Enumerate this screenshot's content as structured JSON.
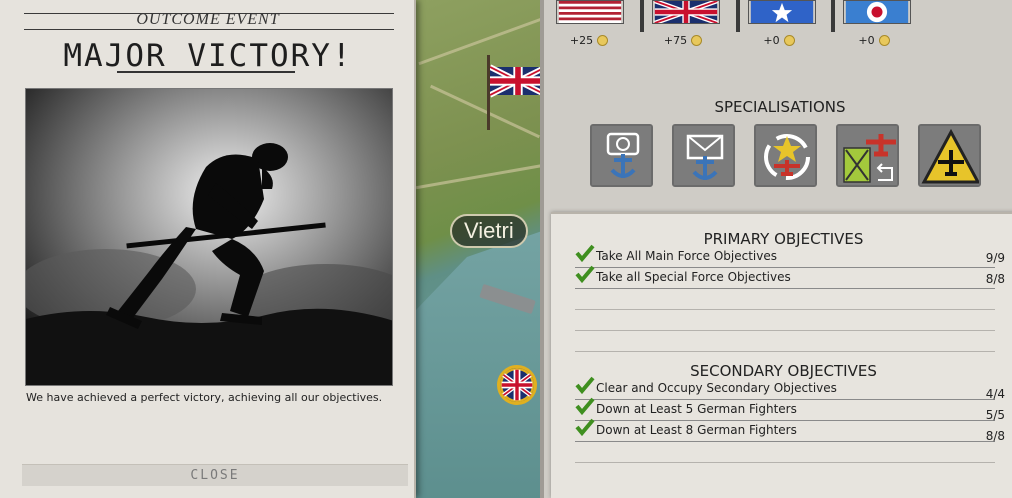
{
  "outcome": {
    "event_label": "OUTCOME EVENT",
    "title": "MAJOR VICTORY!",
    "description": "We have achieved a perfect victory, achieving all our objectives.",
    "close_label": "CLOSE"
  },
  "map": {
    "town_label": "Vietri"
  },
  "nations": [
    {
      "flag_icon": "usa-flag-icon",
      "amount": "+25"
    },
    {
      "flag_icon": "uk-flag-icon",
      "amount": "+75"
    },
    {
      "flag_icon": "free-france-flag-icon",
      "amount": "+0"
    },
    {
      "flag_icon": "raf-roundel-icon",
      "amount": "+0"
    }
  ],
  "specialisations": {
    "title": "SPECIALISATIONS",
    "icons": [
      "naval-recon-icon",
      "naval-mail-icon",
      "air-cycle-icon",
      "air-supply-icon",
      "air-warning-icon"
    ]
  },
  "objectives": {
    "primary_title": "PRIMARY OBJECTIVES",
    "primary": [
      {
        "label": "Take All Main Force Objectives",
        "score": "9/9"
      },
      {
        "label": "Take all Special Force  Objectives",
        "score": "8/8"
      }
    ],
    "secondary_title": "SECONDARY OBJECTIVES",
    "secondary": [
      {
        "label": "Clear and Occupy Secondary Objectives",
        "score": "4/4"
      },
      {
        "label": "Down at Least 5 German Fighters",
        "score": "5/5"
      },
      {
        "label": "Down at Least 8 German Fighters",
        "score": "8/8"
      }
    ]
  },
  "colors": {
    "check_green": "#3f8f1f",
    "coin_gold": "#e8c85c",
    "warning_yellow": "#e7c42a"
  }
}
